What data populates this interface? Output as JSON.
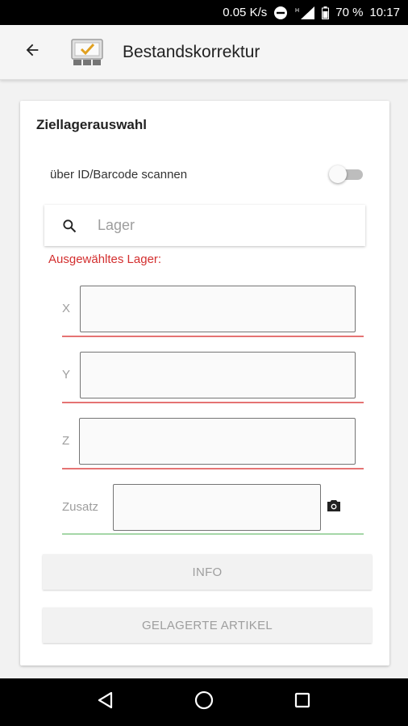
{
  "status_bar": {
    "speed": "0.05 K/s",
    "network": "H",
    "battery": "70 %",
    "time": "10:17"
  },
  "app_bar": {
    "title": "Bestandskorrektur",
    "back_icon": "arrow-left-icon",
    "logo_icon": "inventory-check-icon"
  },
  "card": {
    "title": "Ziellagerauswahl",
    "toggle": {
      "label": "über ID/Barcode scannen",
      "checked": false
    },
    "search": {
      "placeholder": "Lager",
      "value": ""
    },
    "selected_label": "Ausgewähltes Lager:",
    "fields": [
      {
        "label": "X",
        "value": "",
        "status_color": "#e57373"
      },
      {
        "label": "Y",
        "value": "",
        "status_color": "#e57373"
      },
      {
        "label": "Z",
        "value": "",
        "status_color": "#e57373"
      },
      {
        "label": "Zusatz",
        "value": "",
        "status_color": "#a5d6a7",
        "icon": "camera-icon"
      }
    ],
    "buttons": {
      "info": "INFO",
      "stored_items": "GELAGERTE ARTIKEL"
    }
  },
  "nav_bar": {
    "back": "triangle-back-icon",
    "home": "circle-home-icon",
    "recents": "square-recents-icon"
  }
}
